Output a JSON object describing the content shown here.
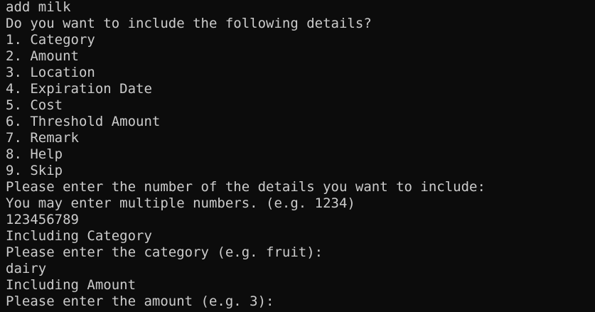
{
  "terminal": {
    "background_color": "#0c0c0c",
    "text_color": "#cccccc",
    "lines": [
      "add milk",
      "Do you want to include the following details?",
      "1. Category",
      "2. Amount",
      "3. Location",
      "4. Expiration Date",
      "5. Cost",
      "6. Threshold Amount",
      "7. Remark",
      "8. Help",
      "9. Skip",
      "Please enter the number of the details you want to include:",
      "You may enter multiple numbers. (e.g. 1234)",
      "123456789",
      "Including Category",
      "Please enter the category (e.g. fruit):",
      "dairy",
      "Including Amount",
      "Please enter the amount (e.g. 3):"
    ]
  }
}
